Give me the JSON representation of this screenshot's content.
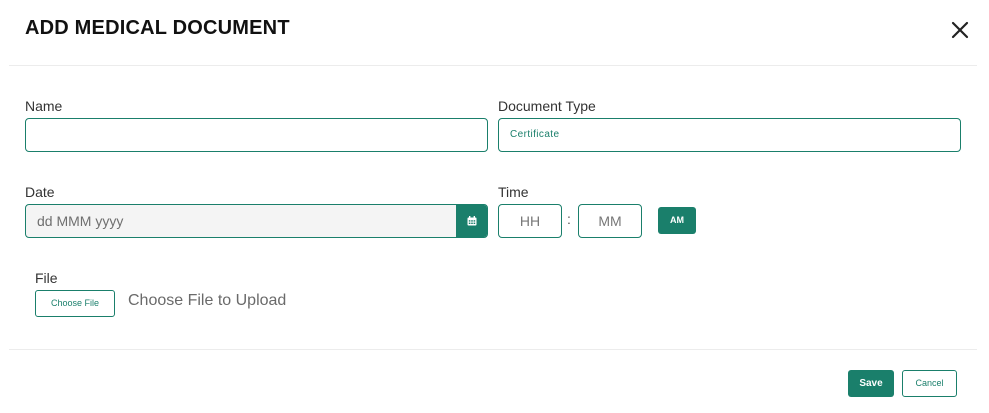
{
  "dialog": {
    "title": "ADD MEDICAL DOCUMENT"
  },
  "form": {
    "name": {
      "label": "Name",
      "value": ""
    },
    "document_type": {
      "label": "Document Type",
      "value": "Certificate"
    },
    "date": {
      "label": "Date",
      "placeholder": "dd MMM yyyy"
    },
    "time": {
      "label": "Time",
      "hours_placeholder": "HH",
      "separator": ":",
      "minutes_placeholder": "MM",
      "period": "AM"
    },
    "file": {
      "label": "File",
      "button_label": "Choose File",
      "hint": "Choose File to Upload"
    }
  },
  "footer": {
    "save_label": "Save",
    "cancel_label": "Cancel"
  },
  "icons": {
    "close": "close-icon",
    "calendar": "calendar-icon"
  },
  "colors": {
    "accent": "#1a7f6b",
    "date_field_bg": "#f4f4f4"
  }
}
